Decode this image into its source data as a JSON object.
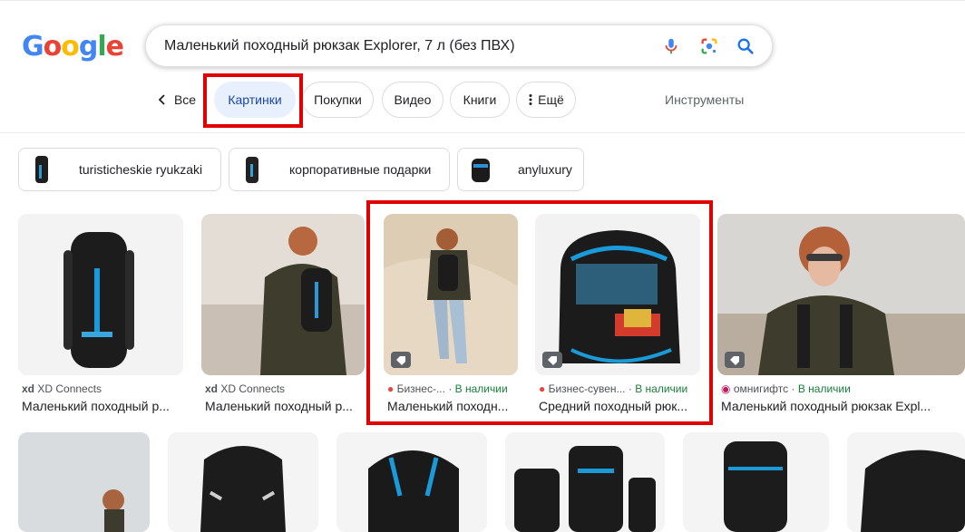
{
  "logo": {
    "letters": [
      "G",
      "o",
      "o",
      "g",
      "l",
      "e"
    ],
    "colors": [
      "#4285f4",
      "#ea4335",
      "#fbbc05",
      "#4285f4",
      "#34a853",
      "#ea4335"
    ]
  },
  "search": {
    "query": "Маленький походный рюкзак Explorer, 7 л (без ПВХ)"
  },
  "tabs": {
    "back_label": "Все",
    "images_label": "Картинки",
    "shopping_label": "Покупки",
    "video_label": "Видео",
    "books_label": "Книги",
    "more_label": "Ещё",
    "tools_label": "Инструменты"
  },
  "chips": [
    {
      "label": "turisticheskie ryukzaki"
    },
    {
      "label": "корпоративные подарки"
    },
    {
      "label": "anyluxury"
    }
  ],
  "results": [
    {
      "source_prefix": "xd",
      "source": "XD Connects",
      "stock": "",
      "title": "Маленький походный р..."
    },
    {
      "source_prefix": "xd",
      "source": "XD Connects",
      "stock": "",
      "title": "Маленький походный р..."
    },
    {
      "source_prefix": "",
      "source": "Бизнес-...",
      "stock": "В наличии",
      "title": "Маленький походн..."
    },
    {
      "source_prefix": "",
      "source": "Бизнес-сувен...",
      "stock": "В наличии",
      "title": "Средний походный рюк..."
    },
    {
      "source_prefix": "",
      "source": "омнигифтс",
      "stock": "В наличии",
      "title": "Маленький походный рюкзак Expl..."
    }
  ],
  "separator": " · ",
  "colors": {
    "highlight": "#e00000",
    "active_tab_bg": "#e8f0fe",
    "in_stock": "#188038",
    "link_blue": "#1a73e8"
  },
  "icons": {
    "mic": "mic-icon",
    "lens": "google-lens-icon",
    "search": "search-icon",
    "back": "chevron-left-icon",
    "more": "more-vert-icon",
    "tag": "price-tag-icon"
  }
}
